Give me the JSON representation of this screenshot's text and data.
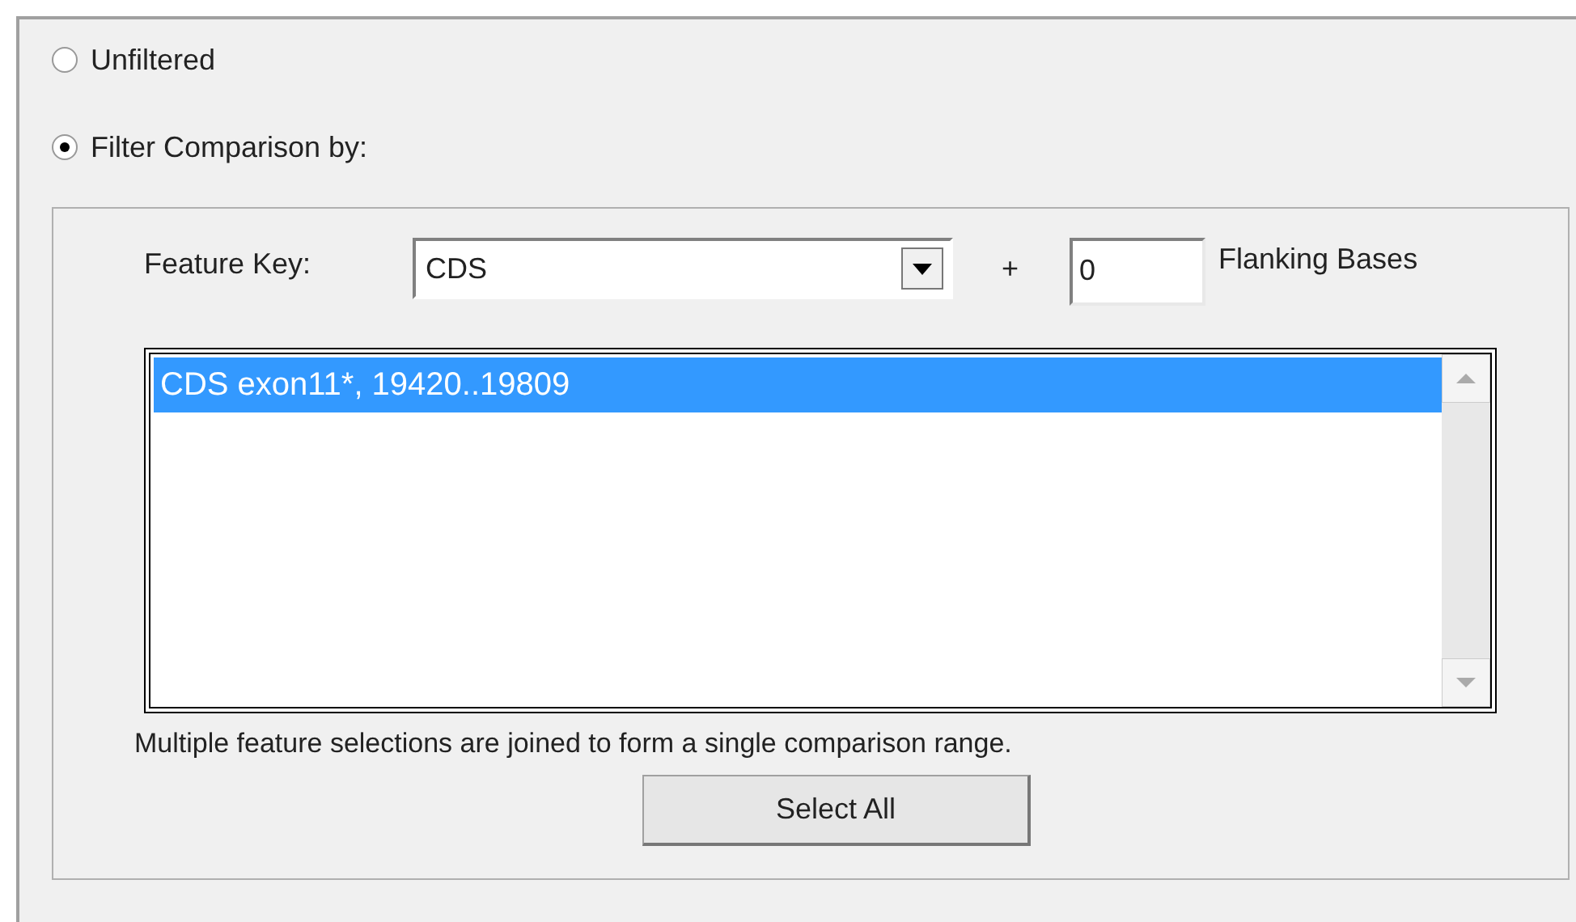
{
  "options": [
    {
      "label": "Unfiltered",
      "selected": false
    },
    {
      "label": "Filter Comparison by:",
      "selected": true
    }
  ],
  "feature_key": {
    "label": "Feature Key:",
    "value": "CDS"
  },
  "plus": "+",
  "flanking": {
    "value": "0",
    "label": "Flanking Bases"
  },
  "features": [
    {
      "label": "CDS exon11*, 19420..19809",
      "selected": true
    }
  ],
  "note": "Multiple feature selections are joined to form a single comparison range.",
  "select_all": "Select All"
}
